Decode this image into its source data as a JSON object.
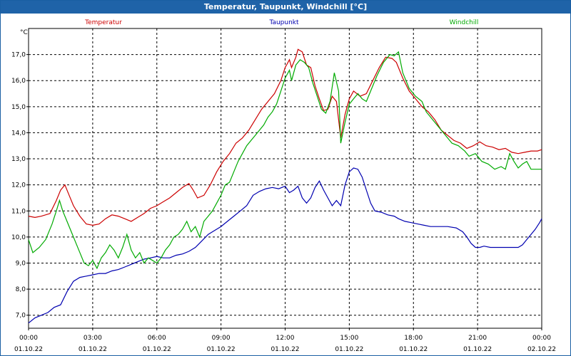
{
  "window": {
    "title": "Temperatur, Taupunkt, Windchill [°C]"
  },
  "chart_data": {
    "type": "line",
    "title": "Temperatur, Taupunkt, Windchill [°C]",
    "ylabel": "°C",
    "xlabel": "",
    "ylim": [
      6.5,
      18.0
    ],
    "xlim_hours": [
      0,
      24
    ],
    "grid": true,
    "legend_placement": "top",
    "y_ticks": [
      "7,0",
      "8,0",
      "9,0",
      "10,0",
      "11,0",
      "12,0",
      "13,0",
      "14,0",
      "15,0",
      "16,0",
      "17,0"
    ],
    "x_ticks": [
      {
        "time": "00:00",
        "date": "01.10.22"
      },
      {
        "time": "03:00",
        "date": "01.10.22"
      },
      {
        "time": "06:00",
        "date": "01.10.22"
      },
      {
        "time": "09:00",
        "date": "01.10.22"
      },
      {
        "time": "12:00",
        "date": "01.10.22"
      },
      {
        "time": "15:00",
        "date": "01.10.22"
      },
      {
        "time": "18:00",
        "date": "01.10.22"
      },
      {
        "time": "21:00",
        "date": "01.10.22"
      },
      {
        "time": "00:00",
        "date": "02.10.22"
      }
    ],
    "series": [
      {
        "name": "Temperatur",
        "color": "#cc0000",
        "points": [
          [
            0,
            10.8
          ],
          [
            0.3,
            10.75
          ],
          [
            0.6,
            10.8
          ],
          [
            1.0,
            10.9
          ],
          [
            1.3,
            11.4
          ],
          [
            1.5,
            11.8
          ],
          [
            1.7,
            12.0
          ],
          [
            1.9,
            11.6
          ],
          [
            2.1,
            11.2
          ],
          [
            2.4,
            10.8
          ],
          [
            2.7,
            10.5
          ],
          [
            3.0,
            10.45
          ],
          [
            3.3,
            10.5
          ],
          [
            3.6,
            10.7
          ],
          [
            3.9,
            10.85
          ],
          [
            4.2,
            10.8
          ],
          [
            4.5,
            10.7
          ],
          [
            4.8,
            10.6
          ],
          [
            5.1,
            10.75
          ],
          [
            5.4,
            10.9
          ],
          [
            5.7,
            11.1
          ],
          [
            6.0,
            11.2
          ],
          [
            6.3,
            11.35
          ],
          [
            6.6,
            11.5
          ],
          [
            6.9,
            11.7
          ],
          [
            7.2,
            11.9
          ],
          [
            7.5,
            12.05
          ],
          [
            7.7,
            11.8
          ],
          [
            7.9,
            11.5
          ],
          [
            8.2,
            11.6
          ],
          [
            8.5,
            12.0
          ],
          [
            8.8,
            12.5
          ],
          [
            9.1,
            12.9
          ],
          [
            9.4,
            13.2
          ],
          [
            9.7,
            13.6
          ],
          [
            10.0,
            13.8
          ],
          [
            10.3,
            14.1
          ],
          [
            10.6,
            14.5
          ],
          [
            10.9,
            14.9
          ],
          [
            11.2,
            15.2
          ],
          [
            11.5,
            15.5
          ],
          [
            11.8,
            16.0
          ],
          [
            12.0,
            16.5
          ],
          [
            12.2,
            16.8
          ],
          [
            12.3,
            16.5
          ],
          [
            12.5,
            16.9
          ],
          [
            12.6,
            17.2
          ],
          [
            12.8,
            17.1
          ],
          [
            13.0,
            16.6
          ],
          [
            13.2,
            16.5
          ],
          [
            13.4,
            15.8
          ],
          [
            13.6,
            15.3
          ],
          [
            13.8,
            14.85
          ],
          [
            14.0,
            14.9
          ],
          [
            14.2,
            15.4
          ],
          [
            14.4,
            15.2
          ],
          [
            14.6,
            13.8
          ],
          [
            14.8,
            14.7
          ],
          [
            15.0,
            15.3
          ],
          [
            15.2,
            15.6
          ],
          [
            15.5,
            15.4
          ],
          [
            15.8,
            15.5
          ],
          [
            16.1,
            16.0
          ],
          [
            16.4,
            16.5
          ],
          [
            16.7,
            16.9
          ],
          [
            17.0,
            16.85
          ],
          [
            17.2,
            16.7
          ],
          [
            17.5,
            16.1
          ],
          [
            17.8,
            15.6
          ],
          [
            18.1,
            15.3
          ],
          [
            18.4,
            15.0
          ],
          [
            18.7,
            14.8
          ],
          [
            19.0,
            14.5
          ],
          [
            19.3,
            14.1
          ],
          [
            19.6,
            13.9
          ],
          [
            19.9,
            13.7
          ],
          [
            20.2,
            13.6
          ],
          [
            20.5,
            13.4
          ],
          [
            20.8,
            13.5
          ],
          [
            21.1,
            13.65
          ],
          [
            21.4,
            13.5
          ],
          [
            21.7,
            13.45
          ],
          [
            22.0,
            13.35
          ],
          [
            22.3,
            13.4
          ],
          [
            22.6,
            13.25
          ],
          [
            22.9,
            13.2
          ],
          [
            23.2,
            13.25
          ],
          [
            23.5,
            13.3
          ],
          [
            23.8,
            13.3
          ],
          [
            24.0,
            13.35
          ]
        ]
      },
      {
        "name": "Taupunkt",
        "color": "#0000b0",
        "points": [
          [
            0,
            6.7
          ],
          [
            0.3,
            6.9
          ],
          [
            0.6,
            7.0
          ],
          [
            0.9,
            7.1
          ],
          [
            1.2,
            7.3
          ],
          [
            1.5,
            7.4
          ],
          [
            1.8,
            7.9
          ],
          [
            2.1,
            8.3
          ],
          [
            2.4,
            8.45
          ],
          [
            2.7,
            8.5
          ],
          [
            3.0,
            8.55
          ],
          [
            3.3,
            8.6
          ],
          [
            3.6,
            8.6
          ],
          [
            3.9,
            8.7
          ],
          [
            4.2,
            8.75
          ],
          [
            4.5,
            8.85
          ],
          [
            4.8,
            8.95
          ],
          [
            5.1,
            9.05
          ],
          [
            5.4,
            9.15
          ],
          [
            5.7,
            9.2
          ],
          [
            6.0,
            9.25
          ],
          [
            6.3,
            9.2
          ],
          [
            6.6,
            9.2
          ],
          [
            6.9,
            9.3
          ],
          [
            7.2,
            9.35
          ],
          [
            7.5,
            9.45
          ],
          [
            7.8,
            9.6
          ],
          [
            8.1,
            9.85
          ],
          [
            8.4,
            10.1
          ],
          [
            8.7,
            10.25
          ],
          [
            9.0,
            10.4
          ],
          [
            9.3,
            10.6
          ],
          [
            9.6,
            10.8
          ],
          [
            9.9,
            11.0
          ],
          [
            10.2,
            11.2
          ],
          [
            10.5,
            11.6
          ],
          [
            10.8,
            11.75
          ],
          [
            11.1,
            11.85
          ],
          [
            11.4,
            11.9
          ],
          [
            11.7,
            11.85
          ],
          [
            12.0,
            11.95
          ],
          [
            12.2,
            11.7
          ],
          [
            12.4,
            11.8
          ],
          [
            12.6,
            11.95
          ],
          [
            12.8,
            11.5
          ],
          [
            13.0,
            11.3
          ],
          [
            13.2,
            11.5
          ],
          [
            13.4,
            11.9
          ],
          [
            13.6,
            12.15
          ],
          [
            13.8,
            11.8
          ],
          [
            14.0,
            11.5
          ],
          [
            14.2,
            11.2
          ],
          [
            14.4,
            11.4
          ],
          [
            14.6,
            11.2
          ],
          [
            14.8,
            12.0
          ],
          [
            15.0,
            12.5
          ],
          [
            15.2,
            12.65
          ],
          [
            15.4,
            12.6
          ],
          [
            15.6,
            12.3
          ],
          [
            15.8,
            11.8
          ],
          [
            16.0,
            11.3
          ],
          [
            16.2,
            11.0
          ],
          [
            16.5,
            10.95
          ],
          [
            16.8,
            10.85
          ],
          [
            17.1,
            10.8
          ],
          [
            17.3,
            10.7
          ],
          [
            17.6,
            10.6
          ],
          [
            17.9,
            10.55
          ],
          [
            18.2,
            10.5
          ],
          [
            18.5,
            10.45
          ],
          [
            18.8,
            10.4
          ],
          [
            19.2,
            10.4
          ],
          [
            19.6,
            10.4
          ],
          [
            20.0,
            10.35
          ],
          [
            20.3,
            10.2
          ],
          [
            20.5,
            10.0
          ],
          [
            20.7,
            9.75
          ],
          [
            20.9,
            9.6
          ],
          [
            21.1,
            9.6
          ],
          [
            21.3,
            9.65
          ],
          [
            21.6,
            9.6
          ],
          [
            22.0,
            9.6
          ],
          [
            22.5,
            9.6
          ],
          [
            22.9,
            9.6
          ],
          [
            23.1,
            9.7
          ],
          [
            23.3,
            9.9
          ],
          [
            23.5,
            10.1
          ],
          [
            23.7,
            10.3
          ],
          [
            23.9,
            10.55
          ],
          [
            24.0,
            10.7
          ]
        ]
      },
      {
        "name": "Windchill",
        "color": "#00aa00",
        "points": [
          [
            0,
            9.9
          ],
          [
            0.2,
            9.4
          ],
          [
            0.5,
            9.6
          ],
          [
            0.8,
            9.9
          ],
          [
            1.1,
            10.5
          ],
          [
            1.3,
            11.0
          ],
          [
            1.45,
            11.4
          ],
          [
            1.6,
            11.0
          ],
          [
            1.8,
            10.6
          ],
          [
            2.0,
            10.2
          ],
          [
            2.2,
            9.8
          ],
          [
            2.4,
            9.4
          ],
          [
            2.6,
            9.0
          ],
          [
            2.8,
            8.9
          ],
          [
            3.0,
            9.1
          ],
          [
            3.2,
            8.8
          ],
          [
            3.4,
            9.2
          ],
          [
            3.6,
            9.4
          ],
          [
            3.8,
            9.7
          ],
          [
            4.0,
            9.5
          ],
          [
            4.2,
            9.2
          ],
          [
            4.4,
            9.6
          ],
          [
            4.6,
            10.1
          ],
          [
            4.8,
            9.5
          ],
          [
            5.0,
            9.2
          ],
          [
            5.2,
            9.4
          ],
          [
            5.4,
            9.0
          ],
          [
            5.6,
            9.2
          ],
          [
            5.8,
            9.1
          ],
          [
            6.0,
            9.0
          ],
          [
            6.2,
            9.2
          ],
          [
            6.4,
            9.5
          ],
          [
            6.6,
            9.7
          ],
          [
            6.8,
            10.0
          ],
          [
            7.0,
            10.1
          ],
          [
            7.2,
            10.3
          ],
          [
            7.4,
            10.6
          ],
          [
            7.6,
            10.2
          ],
          [
            7.8,
            10.4
          ],
          [
            8.0,
            10.0
          ],
          [
            8.2,
            10.6
          ],
          [
            8.4,
            10.8
          ],
          [
            8.6,
            11.0
          ],
          [
            8.8,
            11.3
          ],
          [
            9.0,
            11.6
          ],
          [
            9.2,
            12.0
          ],
          [
            9.4,
            12.1
          ],
          [
            9.6,
            12.5
          ],
          [
            9.8,
            12.9
          ],
          [
            10.0,
            13.2
          ],
          [
            10.2,
            13.5
          ],
          [
            10.4,
            13.7
          ],
          [
            10.6,
            13.9
          ],
          [
            10.8,
            14.1
          ],
          [
            11.0,
            14.3
          ],
          [
            11.2,
            14.6
          ],
          [
            11.4,
            14.8
          ],
          [
            11.6,
            15.1
          ],
          [
            11.8,
            15.6
          ],
          [
            12.0,
            16.1
          ],
          [
            12.2,
            16.4
          ],
          [
            12.3,
            16.0
          ],
          [
            12.5,
            16.6
          ],
          [
            12.7,
            16.8
          ],
          [
            12.9,
            16.7
          ],
          [
            13.1,
            16.5
          ],
          [
            13.3,
            15.9
          ],
          [
            13.5,
            15.4
          ],
          [
            13.7,
            14.9
          ],
          [
            13.9,
            14.75
          ],
          [
            14.1,
            15.2
          ],
          [
            14.3,
            16.3
          ],
          [
            14.5,
            15.6
          ],
          [
            14.6,
            13.6
          ],
          [
            14.8,
            14.4
          ],
          [
            15.0,
            15.1
          ],
          [
            15.2,
            15.3
          ],
          [
            15.4,
            15.5
          ],
          [
            15.6,
            15.3
          ],
          [
            15.8,
            15.2
          ],
          [
            16.0,
            15.6
          ],
          [
            16.3,
            16.2
          ],
          [
            16.6,
            16.7
          ],
          [
            16.9,
            17.0
          ],
          [
            17.1,
            16.95
          ],
          [
            17.3,
            17.1
          ],
          [
            17.5,
            16.3
          ],
          [
            17.8,
            15.7
          ],
          [
            18.1,
            15.4
          ],
          [
            18.4,
            15.2
          ],
          [
            18.6,
            14.8
          ],
          [
            18.9,
            14.5
          ],
          [
            19.2,
            14.2
          ],
          [
            19.5,
            13.9
          ],
          [
            19.8,
            13.6
          ],
          [
            20.1,
            13.5
          ],
          [
            20.4,
            13.3
          ],
          [
            20.6,
            13.1
          ],
          [
            20.9,
            13.2
          ],
          [
            21.2,
            12.9
          ],
          [
            21.5,
            12.8
          ],
          [
            21.8,
            12.6
          ],
          [
            22.1,
            12.7
          ],
          [
            22.3,
            12.6
          ],
          [
            22.5,
            13.2
          ],
          [
            22.7,
            12.9
          ],
          [
            22.9,
            12.65
          ],
          [
            23.1,
            12.8
          ],
          [
            23.3,
            12.9
          ],
          [
            23.5,
            12.6
          ],
          [
            23.8,
            12.6
          ],
          [
            24.0,
            12.6
          ]
        ]
      }
    ]
  }
}
